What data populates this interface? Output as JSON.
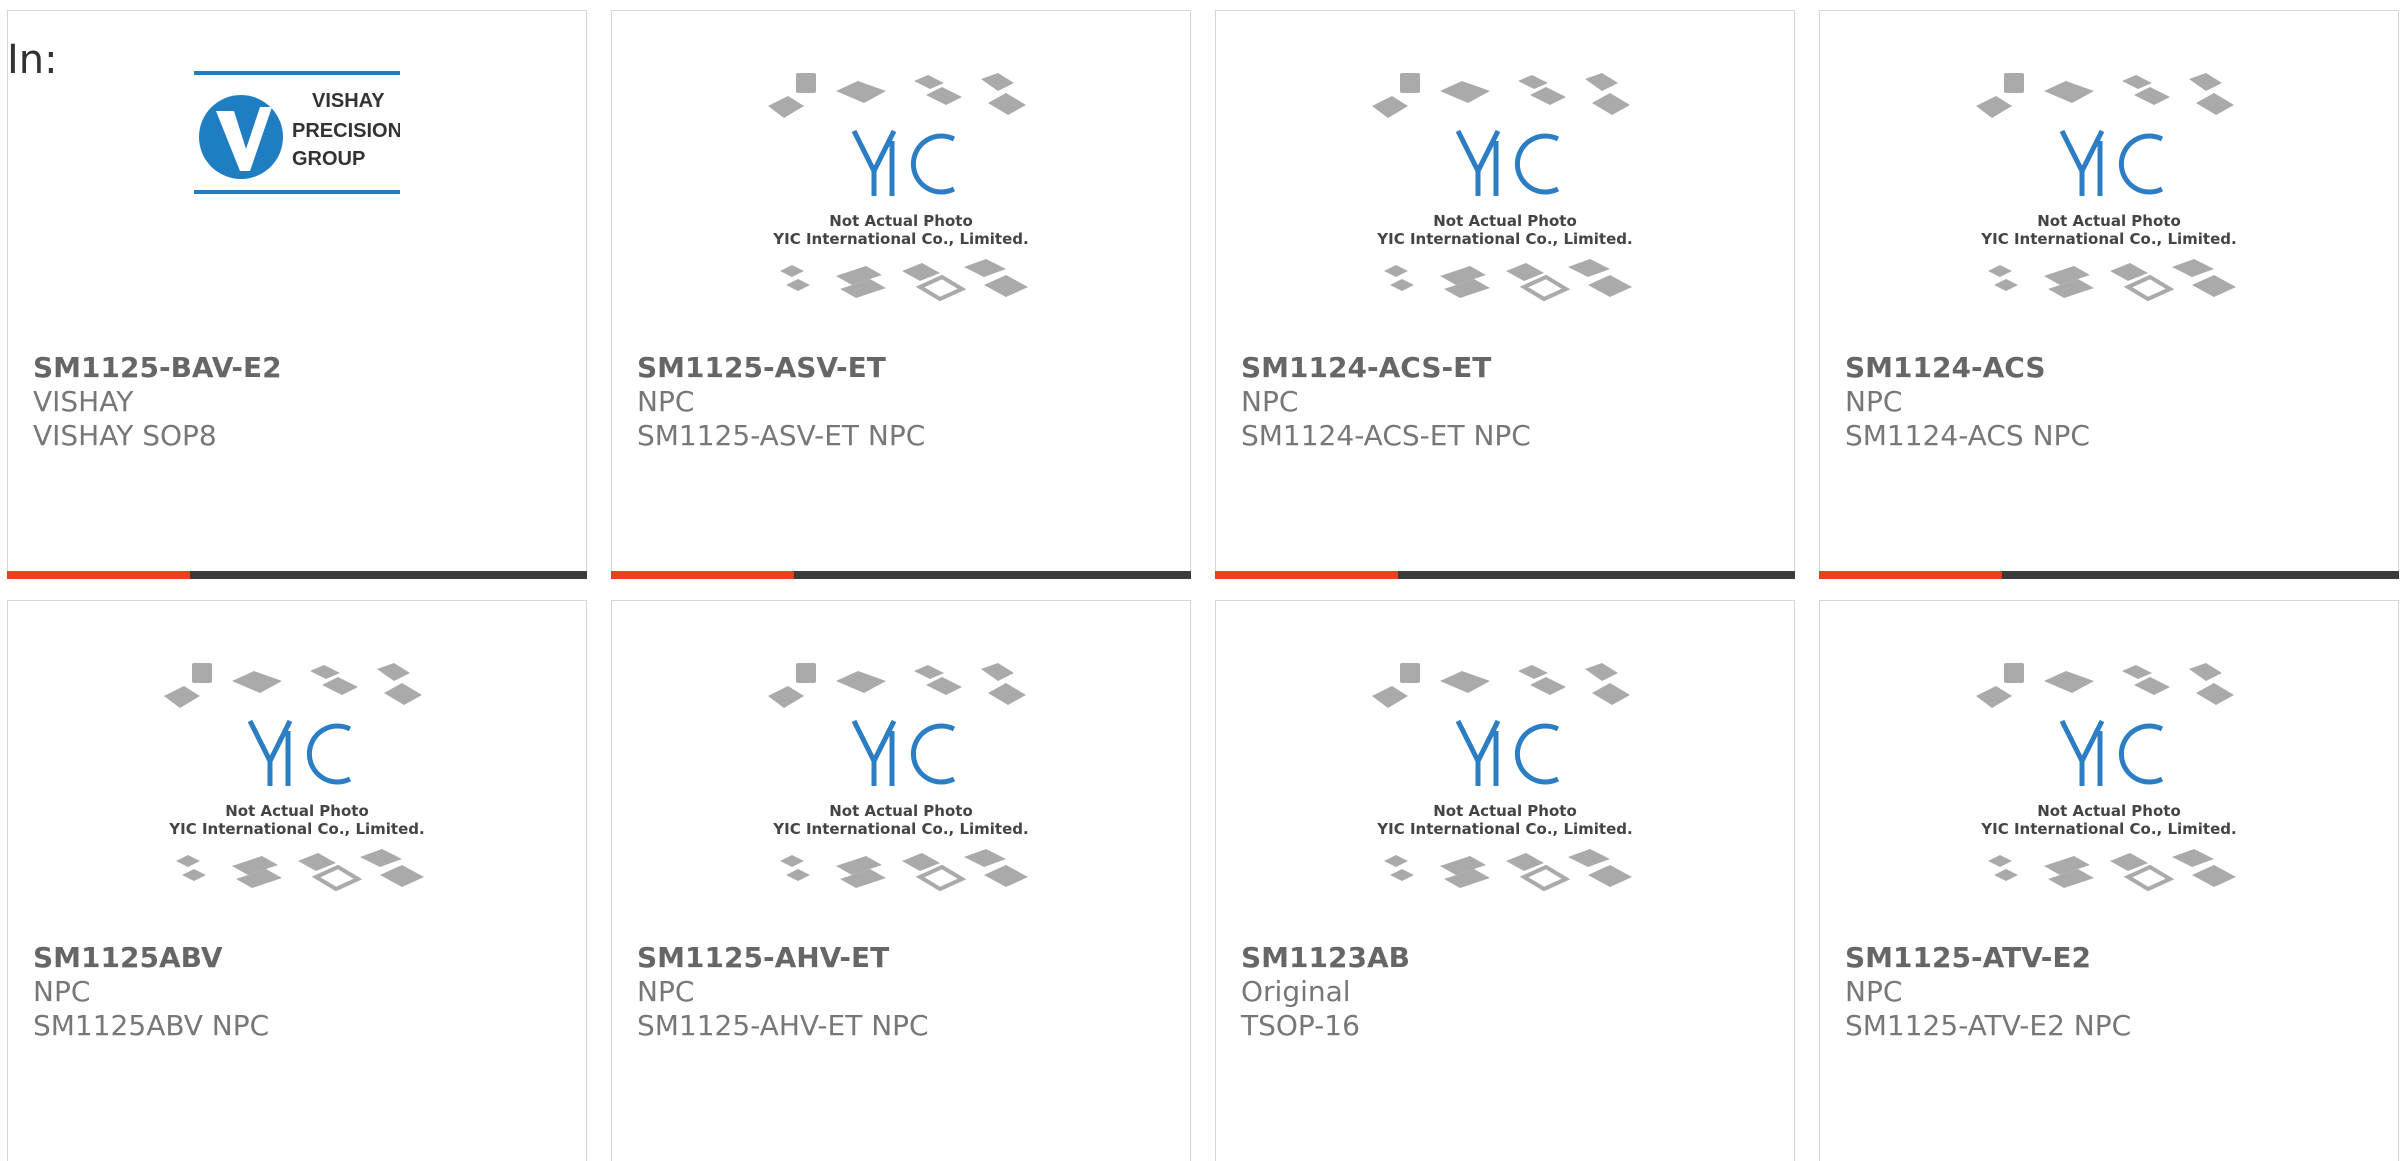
{
  "page": {
    "label": "In:"
  },
  "products": [
    {
      "part": "SM1125-BAV-E2",
      "brand": "VISHAY",
      "desc": "VISHAY SOP8",
      "image": "vishay-logo",
      "brand_logo": [
        "VISHAY",
        "PRECISION",
        "GROUP"
      ],
      "has_bar": true
    },
    {
      "part": "SM1125-ASV-ET",
      "brand": "NPC",
      "desc": "SM1125-ASV-ET NPC",
      "image": "yic-placeholder",
      "has_bar": true
    },
    {
      "part": "SM1124-ACS-ET",
      "brand": "NPC",
      "desc": "SM1124-ACS-ET NPC",
      "image": "yic-placeholder",
      "has_bar": true
    },
    {
      "part": "SM1124-ACS",
      "brand": "NPC",
      "desc": "SM1124-ACS NPC",
      "image": "yic-placeholder",
      "has_bar": true
    },
    {
      "part": "SM1125ABV",
      "brand": "NPC",
      "desc": "SM1125ABV NPC",
      "image": "yic-placeholder",
      "has_bar": false
    },
    {
      "part": "SM1125-AHV-ET",
      "brand": "NPC",
      "desc": "SM1125-AHV-ET NPC",
      "image": "yic-placeholder",
      "has_bar": false
    },
    {
      "part": "SM1123AB",
      "brand": "Original",
      "desc": "TSOP-16",
      "image": "yic-placeholder",
      "has_bar": false
    },
    {
      "part": "SM1125-ATV-E2",
      "brand": "NPC",
      "desc": "SM1125-ATV-E2 NPC",
      "image": "yic-placeholder",
      "has_bar": false
    }
  ],
  "placeholder": {
    "caption_line1": "Not Actual Photo",
    "caption_line2": "YIC International Co., Limited.",
    "logo_text": "YIC"
  },
  "colors": {
    "accent": "#e8411c",
    "bar": "#3b3b3b",
    "vishay_blue": "#1f7dc1",
    "yic_blue": "#2b7ec3"
  }
}
